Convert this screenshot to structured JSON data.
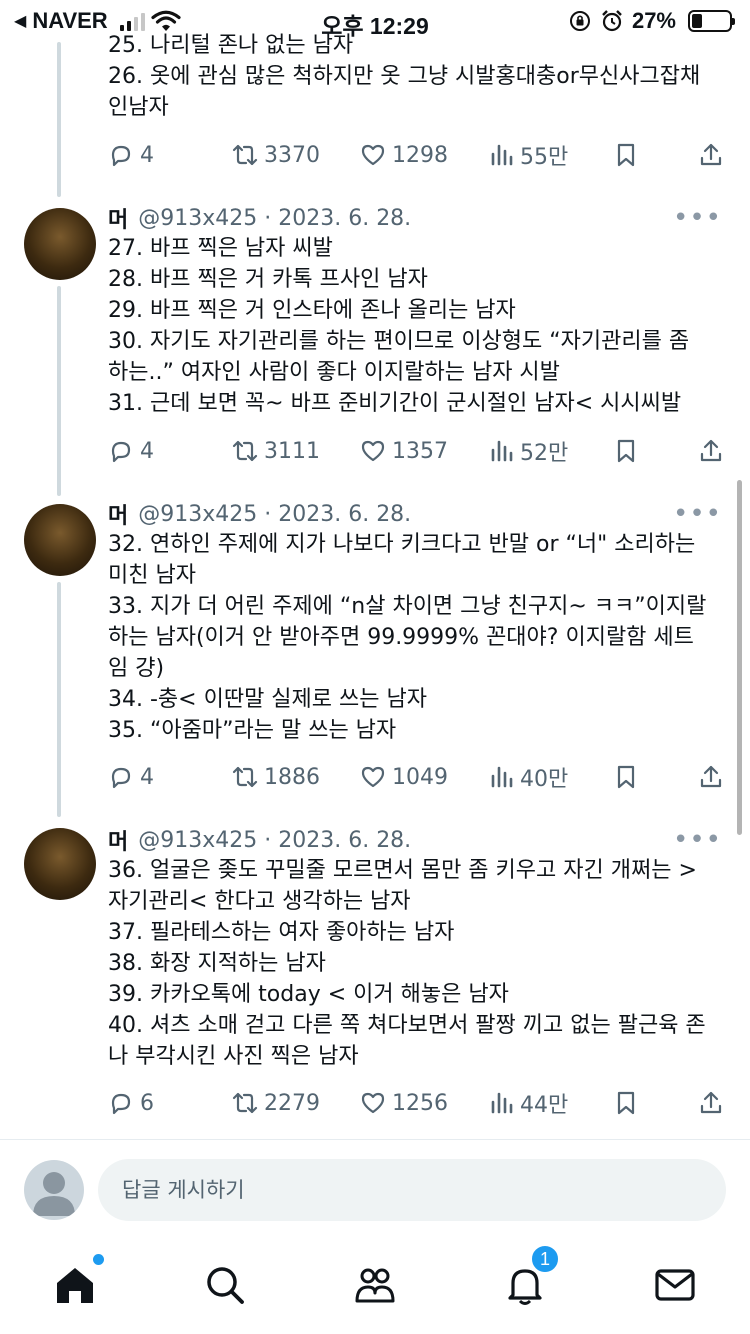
{
  "status_bar": {
    "back_app": "NAVER",
    "time": "오후 12:29",
    "battery": "27%",
    "battery_level": 0.27
  },
  "tweets": [
    {
      "lines": [
        "25. 나리털 존나 없는 남자",
        "26. 옷에 관심 많은 척하지만 옷 그냥 시발홍대충or무신사그잡채",
        "인남자"
      ],
      "replies": "4",
      "retweets": "3370",
      "likes": "1298",
      "views": "55만"
    },
    {
      "name": "머",
      "handle_date": "@913x425 · 2023. 6. 28.",
      "lines": [
        "27. 바프 찍은 남자 씨발",
        "28. 바프 찍은 거 카톡 프사인 남자",
        "29. 바프 찍은 거 인스타에 존나 올리는 남자",
        "30. 자기도 자기관리를 하는 편이므로 이상형도 “자기관리를 좀",
        "하는..” 여자인 사람이 좋다 이지랄하는 남자 시발",
        "31. 근데 보면 꼭~ 바프 준비기간이 군시절인 남자< 시시씨발"
      ],
      "replies": "4",
      "retweets": "3111",
      "likes": "1357",
      "views": "52만"
    },
    {
      "name": "머",
      "handle_date": "@913x425 · 2023. 6. 28.",
      "lines": [
        "32. 연하인 주제에 지가 나보다 키크다고 반말 or “너\" 소리하는",
        "미친 남자",
        "33. 지가 더 어린 주제에 “n살 차이면 그냥 친구지~ ㅋㅋ”이지랄",
        "하는 남자(이거 안 받아주면 99.9999% 꼰대야? 이지랄함 세트",
        "임 걍)",
        "34. -충< 이딴말 실제로 쓰는 남자",
        "35. “아줌마”라는 말 쓰는 남자"
      ],
      "replies": "4",
      "retweets": "1886",
      "likes": "1049",
      "views": "40만"
    },
    {
      "name": "머",
      "handle_date": "@913x425 · 2023. 6. 28.",
      "lines": [
        "36. 얼굴은 좆도 꾸밀줄 모르면서 몸만 좀 키우고 자긴 개쩌는 >",
        "자기관리< 한다고 생각하는 남자",
        "37. 필라테스하는 여자 좋아하는 남자",
        "38. 화장 지적하는 남자",
        "39. 카카오톡에 today < 이거 해놓은 남자",
        "40. 셔츠 소매 걷고 다른 쪽 쳐다보면서 팔짱 끼고 없는 팔근육 존",
        "나 부각시킨 사진 찍은 남자"
      ],
      "replies": "6",
      "retweets": "2279",
      "likes": "1256",
      "views": "44만"
    }
  ],
  "reply_bar": {
    "placeholder": "답글 게시하기"
  },
  "tab_bar": {
    "items": [
      "home-icon",
      "search-icon",
      "communities-icon",
      "notifications-icon",
      "messages-icon"
    ],
    "notification_count": "1"
  },
  "colors": {
    "text": "#0f1419",
    "secondary": "#536471",
    "accent": "#1d9bf0",
    "divider": "#e6ecf0"
  }
}
